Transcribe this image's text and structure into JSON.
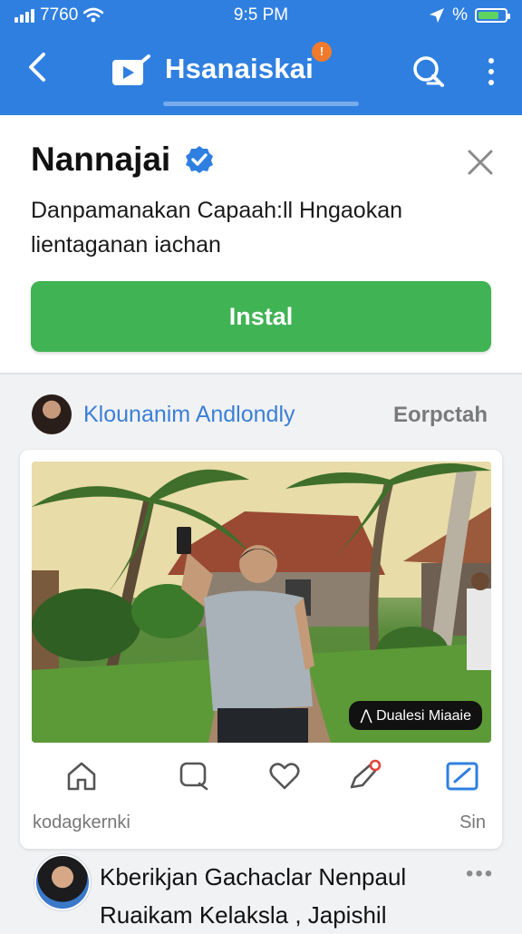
{
  "status_bar": {
    "carrier": "7760",
    "time": "9:5 PM",
    "battery_label": "%",
    "battery_level": 0.8
  },
  "app_bar": {
    "title": "Hsanaiskai",
    "badge": "!"
  },
  "promo": {
    "title": "Nannajai",
    "description_line1": "Danpamanakan Capaah:ll Hngaokan",
    "description_line2": "lientaganan iachan",
    "install_label": "Instal"
  },
  "account": {
    "name": "Klounanim Andlondly",
    "action": "Eorpctah"
  },
  "post_card": {
    "video_badge": "Dualesi Miaaie",
    "footer_left": "kodagkernki",
    "footer_right": "Sin"
  },
  "next_post": {
    "line1": "Kberikjan Gachaclar Nenpaul",
    "line2": "Ruaikam Kelaksla , Japishil",
    "more": "•••"
  },
  "colors": {
    "header": "#2f7fe0",
    "install": "#40b354",
    "link": "#3a7fd6",
    "badge": "#f07a2c"
  }
}
